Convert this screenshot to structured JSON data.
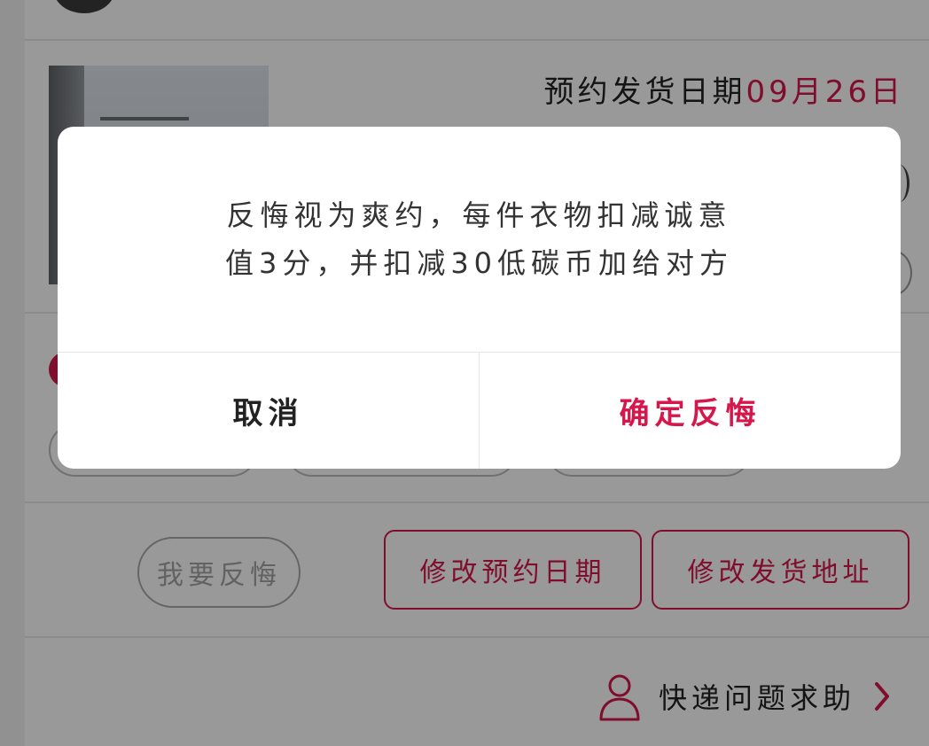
{
  "order": {
    "ship_date_label": "预约发货日期",
    "ship_date_value": "09月26日"
  },
  "actions": {
    "regret_label": "我要反悔",
    "change_date_label": "修改预约日期",
    "change_address_label": "修改发货地址"
  },
  "help": {
    "label": "快递问题求助",
    "icon": "person-icon",
    "chevron_icon": "chevron-right-icon"
  },
  "dialog": {
    "message_line1": "反悔视为爽约，每件衣物扣减诚意",
    "message_line2": "值3分，并扣减30低碳币加给对方",
    "cancel_label": "取消",
    "confirm_label": "确定反悔"
  },
  "colors": {
    "accent": "#d6174b",
    "overlay": "rgba(0,0,0,0.4)"
  }
}
